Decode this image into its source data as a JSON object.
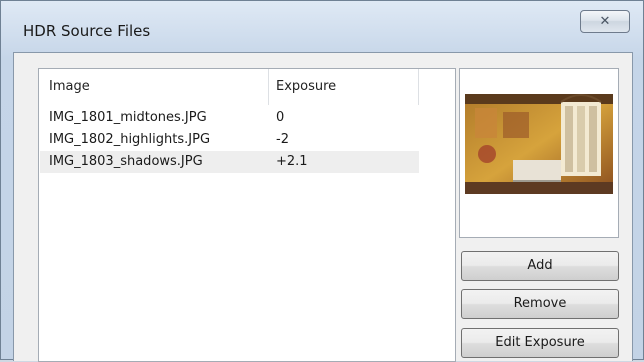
{
  "dialog": {
    "title": "HDR Source Files",
    "close_glyph": "✕"
  },
  "file_list": {
    "columns": [
      "Image",
      "Exposure"
    ],
    "rows": [
      {
        "image": "IMG_1801_midtones.JPG",
        "exposure": "0"
      },
      {
        "image": "IMG_1802_highlights.JPG",
        "exposure": "-2"
      },
      {
        "image": "IMG_1803_shadows.JPG",
        "exposure": "+2.1"
      }
    ],
    "selected_row": 2
  },
  "preview": {
    "icon": "photo-thumbnail"
  },
  "buttons": {
    "add": "Add",
    "remove": "Remove",
    "edit_exposure": "Edit Exposure"
  }
}
